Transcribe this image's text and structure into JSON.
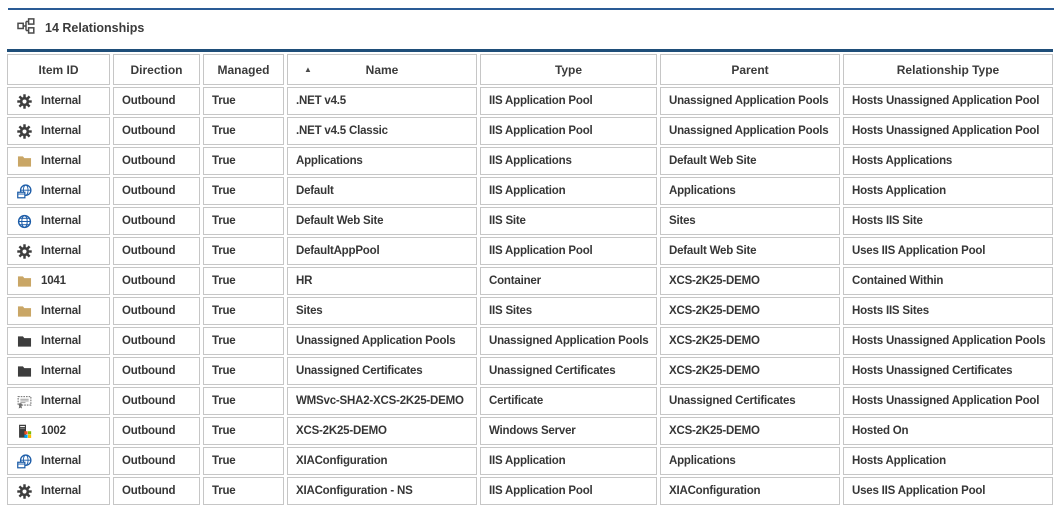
{
  "header": {
    "icon": "relationships-icon",
    "title": "14 Relationships"
  },
  "colors": {
    "accent_rule": "#2a5b95",
    "table_top_border": "#1f4e79",
    "cell_border": "#c6c6c6",
    "text": "#3a3a3a",
    "folder_tan": "#c9a666",
    "icon_dark": "#3d3d3d",
    "icon_blue": "#1d5da8"
  },
  "table": {
    "columns": [
      {
        "key": "item_id",
        "label": "Item ID"
      },
      {
        "key": "direction",
        "label": "Direction"
      },
      {
        "key": "managed",
        "label": "Managed"
      },
      {
        "key": "name",
        "label": "Name",
        "sorted": true,
        "sort_glyph": "▲"
      },
      {
        "key": "type",
        "label": "Type"
      },
      {
        "key": "parent",
        "label": "Parent"
      },
      {
        "key": "relationship_type",
        "label": "Relationship Type"
      }
    ],
    "rows": [
      {
        "icon": "gear-icon",
        "item_id": "Internal",
        "direction": "Outbound",
        "managed": "True",
        "name": ".NET v4.5",
        "type": "IIS Application Pool",
        "parent": "Unassigned Application Pools",
        "relationship_type": "Hosts Unassigned Application Pool"
      },
      {
        "icon": "gear-icon",
        "item_id": "Internal",
        "direction": "Outbound",
        "managed": "True",
        "name": ".NET v4.5 Classic",
        "type": "IIS Application Pool",
        "parent": "Unassigned Application Pools",
        "relationship_type": "Hosts Unassigned Application Pool"
      },
      {
        "icon": "folder-icon",
        "item_id": "Internal",
        "direction": "Outbound",
        "managed": "True",
        "name": "Applications",
        "type": "IIS Applications",
        "parent": "Default Web Site",
        "relationship_type": "Hosts Applications"
      },
      {
        "icon": "web-application-icon",
        "item_id": "Internal",
        "direction": "Outbound",
        "managed": "True",
        "name": "Default",
        "type": "IIS Application",
        "parent": "Applications",
        "relationship_type": "Hosts Application"
      },
      {
        "icon": "globe-icon",
        "item_id": "Internal",
        "direction": "Outbound",
        "managed": "True",
        "name": "Default Web Site",
        "type": "IIS Site",
        "parent": "Sites",
        "relationship_type": "Hosts IIS Site"
      },
      {
        "icon": "gear-icon",
        "item_id": "Internal",
        "direction": "Outbound",
        "managed": "True",
        "name": "DefaultAppPool",
        "type": "IIS Application Pool",
        "parent": "Default Web Site",
        "relationship_type": "Uses IIS Application Pool"
      },
      {
        "icon": "folder-icon",
        "item_id": "1041",
        "direction": "Outbound",
        "managed": "True",
        "name": "HR",
        "type": "Container",
        "parent": "XCS-2K25-DEMO",
        "relationship_type": "Contained Within"
      },
      {
        "icon": "folder-icon",
        "item_id": "Internal",
        "direction": "Outbound",
        "managed": "True",
        "name": "Sites",
        "type": "IIS Sites",
        "parent": "XCS-2K25-DEMO",
        "relationship_type": "Hosts IIS Sites"
      },
      {
        "icon": "folder-dark-icon",
        "item_id": "Internal",
        "direction": "Outbound",
        "managed": "True",
        "name": "Unassigned Application Pools",
        "type": "Unassigned Application Pools",
        "parent": "XCS-2K25-DEMO",
        "relationship_type": "Hosts Unassigned Application Pools"
      },
      {
        "icon": "folder-dark-icon",
        "item_id": "Internal",
        "direction": "Outbound",
        "managed": "True",
        "name": "Unassigned Certificates",
        "type": "Unassigned Certificates",
        "parent": "XCS-2K25-DEMO",
        "relationship_type": "Hosts Unassigned Certificates"
      },
      {
        "icon": "certificate-icon",
        "item_id": "Internal",
        "direction": "Outbound",
        "managed": "True",
        "name": "WMSvc-SHA2-XCS-2K25-DEMO",
        "type": "Certificate",
        "parent": "Unassigned Certificates",
        "relationship_type": "Hosts Unassigned Application Pool"
      },
      {
        "icon": "windows-server-icon",
        "item_id": "1002",
        "direction": "Outbound",
        "managed": "True",
        "name": "XCS-2K25-DEMO",
        "type": "Windows Server",
        "parent": "XCS-2K25-DEMO",
        "relationship_type": "Hosted On"
      },
      {
        "icon": "web-application-icon",
        "item_id": "Internal",
        "direction": "Outbound",
        "managed": "True",
        "name": "XIAConfiguration",
        "type": "IIS Application",
        "parent": "Applications",
        "relationship_type": "Hosts Application"
      },
      {
        "icon": "gear-icon",
        "item_id": "Internal",
        "direction": "Outbound",
        "managed": "True",
        "name": "XIAConfiguration - NS",
        "type": "IIS Application Pool",
        "parent": "XIAConfiguration",
        "relationship_type": "Uses IIS Application Pool"
      }
    ]
  }
}
